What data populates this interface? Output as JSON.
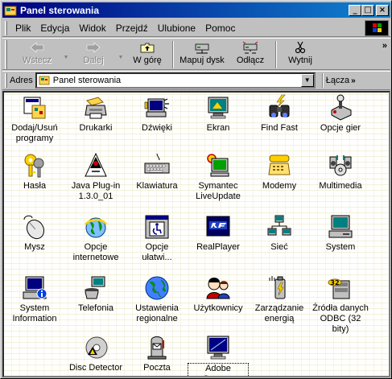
{
  "window": {
    "title": "Panel sterowania",
    "controls": {
      "minimize": "_",
      "maximize": "□",
      "close": "×"
    }
  },
  "menubar": {
    "items": [
      "Plik",
      "Edycja",
      "Widok",
      "Przejdź",
      "Ulubione",
      "Pomoc"
    ]
  },
  "toolbar": {
    "back": "Wstecz",
    "forward": "Dalej",
    "up": "W górę",
    "map_drive": "Mapuj dysk",
    "disconnect": "Odłącz",
    "cut": "Wytnij",
    "more": "»"
  },
  "address": {
    "label": "Adres",
    "value": "Panel sterowania",
    "links": "Łącza",
    "links_more": "»"
  },
  "items": [
    {
      "label": "Dodaj/Usuń\nprogramy",
      "icon": "add-remove-programs-icon"
    },
    {
      "label": "Drukarki",
      "icon": "printers-icon"
    },
    {
      "label": "Dźwięki",
      "icon": "sounds-icon"
    },
    {
      "label": "Ekran",
      "icon": "display-icon"
    },
    {
      "label": "Find Fast",
      "icon": "find-fast-icon"
    },
    {
      "label": "Opcje gier",
      "icon": "game-controllers-icon"
    },
    {
      "label": "Hasła",
      "icon": "passwords-icon"
    },
    {
      "label": "Java Plug-in\n1.3.0_01",
      "icon": "java-plugin-icon"
    },
    {
      "label": "Klawiatura",
      "icon": "keyboard-icon"
    },
    {
      "label": "Symantec\nLiveUpdate",
      "icon": "liveupdate-icon"
    },
    {
      "label": "Modemy",
      "icon": "modem-icon"
    },
    {
      "label": "Multimedia",
      "icon": "multimedia-icon"
    },
    {
      "label": "Mysz",
      "icon": "mouse-icon"
    },
    {
      "label": "Opcje\ninternetowe",
      "icon": "internet-options-icon"
    },
    {
      "label": "Opcje\nułatwi...",
      "icon": "accessibility-icon"
    },
    {
      "label": "RealPlayer",
      "icon": "realplayer-icon"
    },
    {
      "label": "Sieć",
      "icon": "network-icon"
    },
    {
      "label": "System",
      "icon": "system-icon"
    },
    {
      "label": "System\nInformation",
      "icon": "system-information-icon"
    },
    {
      "label": "Telefonia",
      "icon": "telephony-icon"
    },
    {
      "label": "Ustawienia\nregionalne",
      "icon": "regional-settings-icon"
    },
    {
      "label": "Użytkownicy",
      "icon": "users-icon"
    },
    {
      "label": "Zarządzanie\nenergią",
      "icon": "power-management-icon"
    },
    {
      "label": "Źródła danych\nODBC (32 bity)",
      "icon": "odbc-icon"
    },
    {
      "label": "Disc Detector",
      "icon": "disc-detector-icon"
    },
    {
      "label": "Poczta",
      "icon": "mail-icon"
    },
    {
      "label": "Adobe Gamma",
      "icon": "adobe-gamma-icon"
    }
  ],
  "colors": {
    "titlebar_start": "#000080",
    "titlebar_end": "#1084d0",
    "face": "#c0c0c0"
  }
}
